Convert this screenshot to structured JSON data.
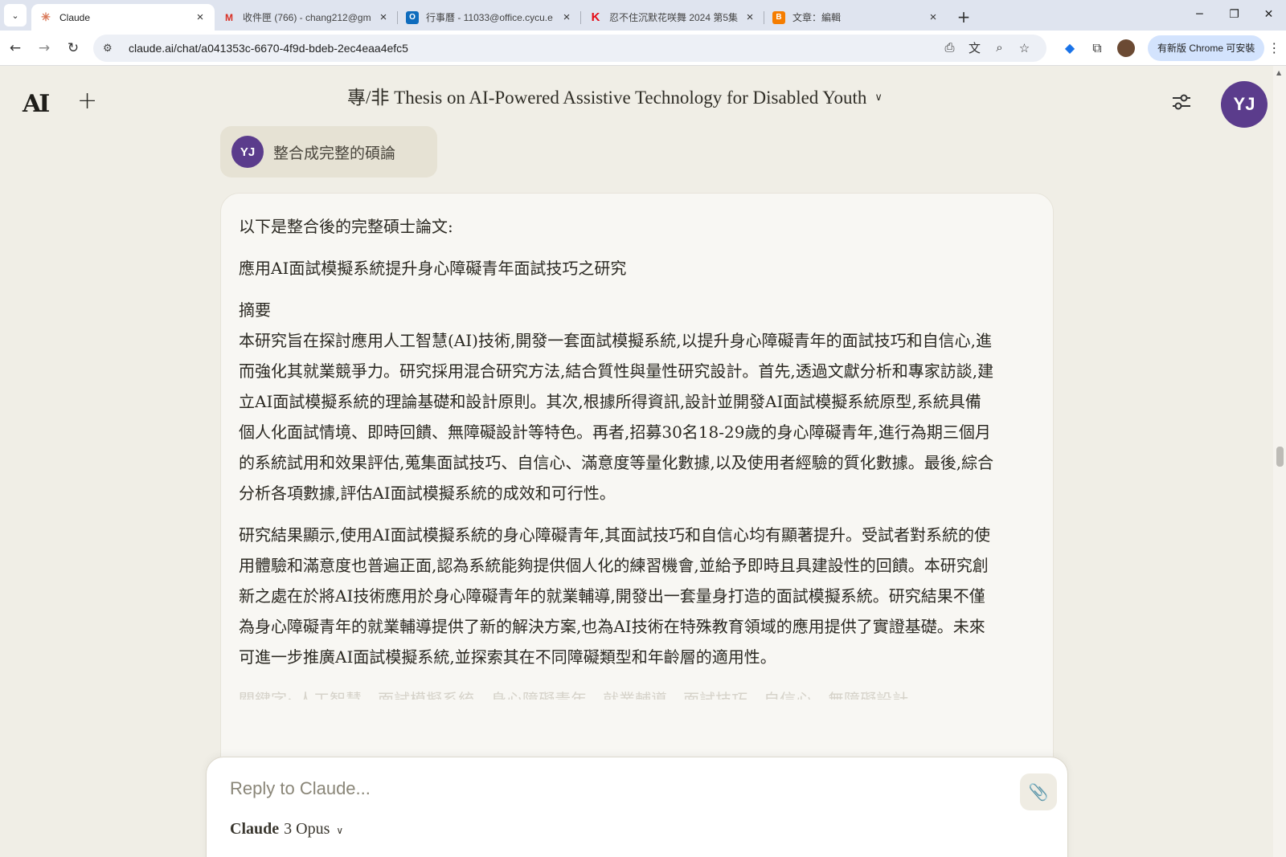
{
  "browser": {
    "tabs": [
      {
        "title": "Claude",
        "favicon": "claude-asterisk-icon",
        "active": true
      },
      {
        "title": "收件匣 (766) - chang212@gm",
        "favicon": "gmail-icon",
        "active": false
      },
      {
        "title": "行事曆 - 11033@office.cycu.e",
        "favicon": "outlook-icon",
        "active": false
      },
      {
        "title": "忍不住沉默花咲舞 2024 第5集",
        "favicon": "k-icon",
        "active": false
      },
      {
        "title": "文章：編輯",
        "favicon": "blogger-icon",
        "active": false
      }
    ],
    "url": "claude.ai/chat/a041353c-6670-4f9d-bdeb-2ec4eaa4efc5",
    "update_label": "有新版 Chrome 可安裝",
    "colors": {
      "tabbar": "#dfe4ef",
      "update_pill": "#d3e3fd"
    }
  },
  "app": {
    "logo": "AI",
    "chat_title": "專/非 Thesis on AI-Powered Assistive Technology for Disabled Youth",
    "user_initials": "YJ",
    "colors": {
      "background": "#f0eee6",
      "avatar": "#5b3c8c"
    }
  },
  "user_message": {
    "text": "整合成完整的碩論"
  },
  "assistant": {
    "intro": "以下是整合後的完整碩士論文:",
    "thesis_title": "應用AI面試模擬系統提升身心障礙青年面試技巧之研究",
    "abstract_heading": "摘要",
    "paragraph1": "本研究旨在探討應用人工智慧(AI)技術,開發一套面試模擬系統,以提升身心障礙青年的面試技巧和自信心,進而強化其就業競爭力。研究採用混合研究方法,結合質性與量性研究設計。首先,透過文獻分析和專家訪談,建立AI面試模擬系統的理論基礎和設計原則。其次,根據所得資訊,設計並開發AI面試模擬系統原型,系統具備個人化面試情境、即時回饋、無障礙設計等特色。再者,招募30名18-29歲的身心障礙青年,進行為期三個月的系統試用和效果評估,蒐集面試技巧、自信心、滿意度等量化數據,以及使用者經驗的質化數據。最後,綜合分析各項數據,評估AI面試模擬系統的成效和可行性。",
    "paragraph2": "研究結果顯示,使用AI面試模擬系統的身心障礙青年,其面試技巧和自信心均有顯著提升。受試者對系統的使用體驗和滿意度也普遍正面,認為系統能夠提供個人化的練習機會,並給予即時且具建設性的回饋。本研究創新之處在於將AI技術應用於身心障礙青年的就業輔導,開發出一套量身打造的面試模擬系統。研究結果不僅為身心障礙青年的就業輔導提供了新的解決方案,也為AI技術在特殊教育領域的應用提供了實證基礎。未來可進一步推廣AI面試模擬系統,並探索其在不同障礙類型和年齡層的適用性。",
    "keywords_partial": "關鍵字: 人工智慧、面試模擬系統、身心障礙青年、就業輔導、面試技巧、自信心、無障礙設計"
  },
  "composer": {
    "placeholder": "Reply to Claude...",
    "model_brand": "Claude",
    "model_version": "3 Opus"
  }
}
